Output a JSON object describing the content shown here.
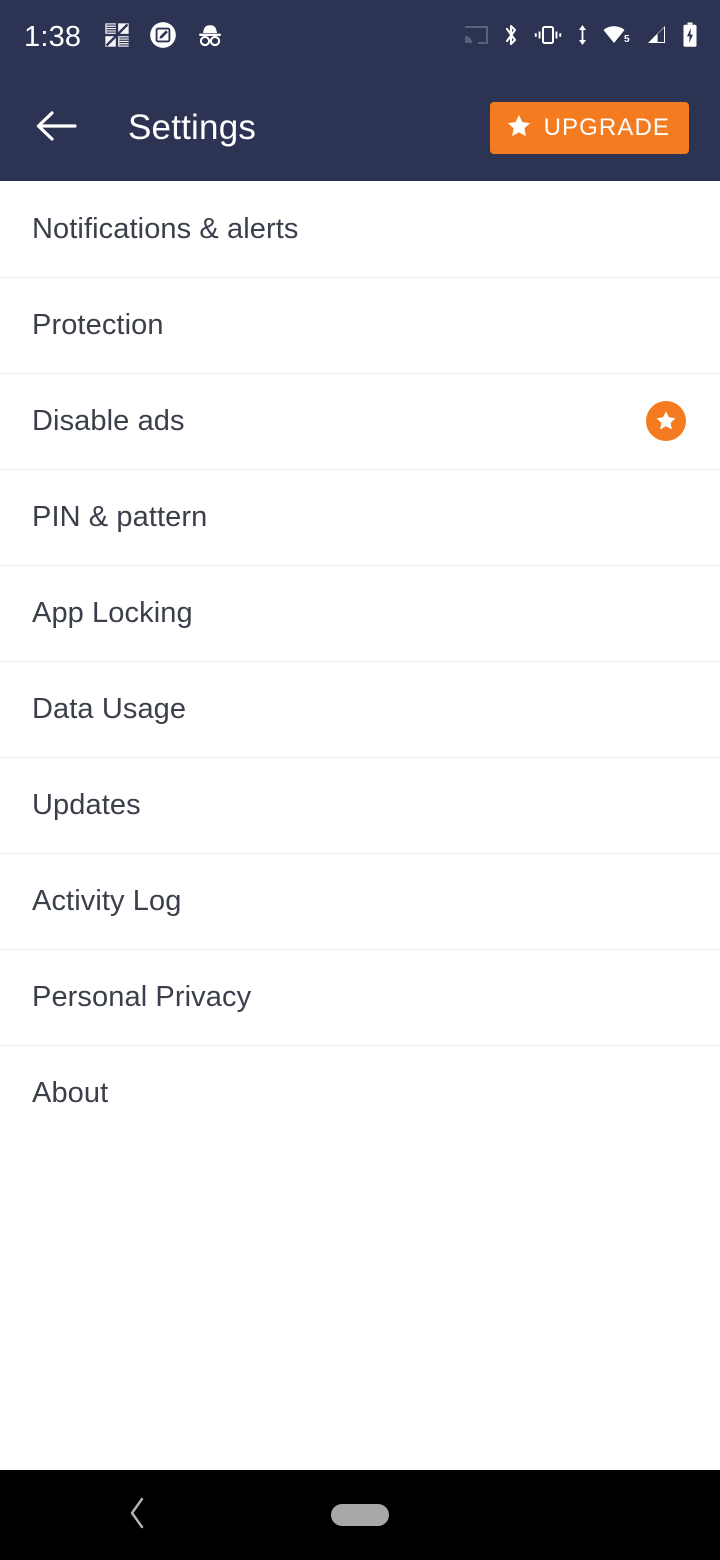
{
  "status_bar": {
    "time": "1:38",
    "background_color": "#2d3453",
    "left_icons": [
      {
        "name": "avg-antivirus-icon",
        "label": "AVG"
      },
      {
        "name": "screenshot-edit-icon",
        "label": "Screenshot"
      },
      {
        "name": "incognito-icon",
        "label": "Incognito"
      }
    ],
    "right_icons": [
      {
        "name": "cast-icon",
        "label": "Cast",
        "state": "inactive"
      },
      {
        "name": "bluetooth-icon",
        "label": "Bluetooth",
        "state": "on"
      },
      {
        "name": "vibrate-icon",
        "label": "Vibrate",
        "state": "on"
      },
      {
        "name": "data-transfer-icon",
        "label": "Data transfer"
      },
      {
        "name": "wifi-icon",
        "label": "Wi-Fi",
        "badge": "5"
      },
      {
        "name": "cellular-signal-icon",
        "label": "Cellular signal"
      },
      {
        "name": "battery-charging-icon",
        "label": "Battery charging"
      }
    ]
  },
  "app_bar": {
    "title": "Settings",
    "back_icon": "arrow-left-icon",
    "upgrade_label": "UPGRADE",
    "upgrade_icon": "star-icon",
    "upgrade_color": "#f47b20",
    "background_color": "#2d3453",
    "title_color": "#ffffff"
  },
  "settings_list": {
    "text_color": "#3a3f4b",
    "divider_color": "#ececee",
    "items": [
      {
        "label": "Notifications & alerts",
        "premium": false
      },
      {
        "label": "Protection",
        "premium": false
      },
      {
        "label": "Disable ads",
        "premium": true,
        "badge_icon": "star-badge-icon",
        "badge_color": "#f47b20"
      },
      {
        "label": "PIN & pattern",
        "premium": false
      },
      {
        "label": "App Locking",
        "premium": false
      },
      {
        "label": "Data Usage",
        "premium": false
      },
      {
        "label": "Updates",
        "premium": false
      },
      {
        "label": "Activity Log",
        "premium": false
      },
      {
        "label": "Personal Privacy",
        "premium": false
      },
      {
        "label": "About",
        "premium": false
      }
    ]
  },
  "navigation_bar": {
    "background_color": "#000000",
    "back_icon": "chevron-left-icon",
    "home_indicator": "home-pill-icon"
  }
}
